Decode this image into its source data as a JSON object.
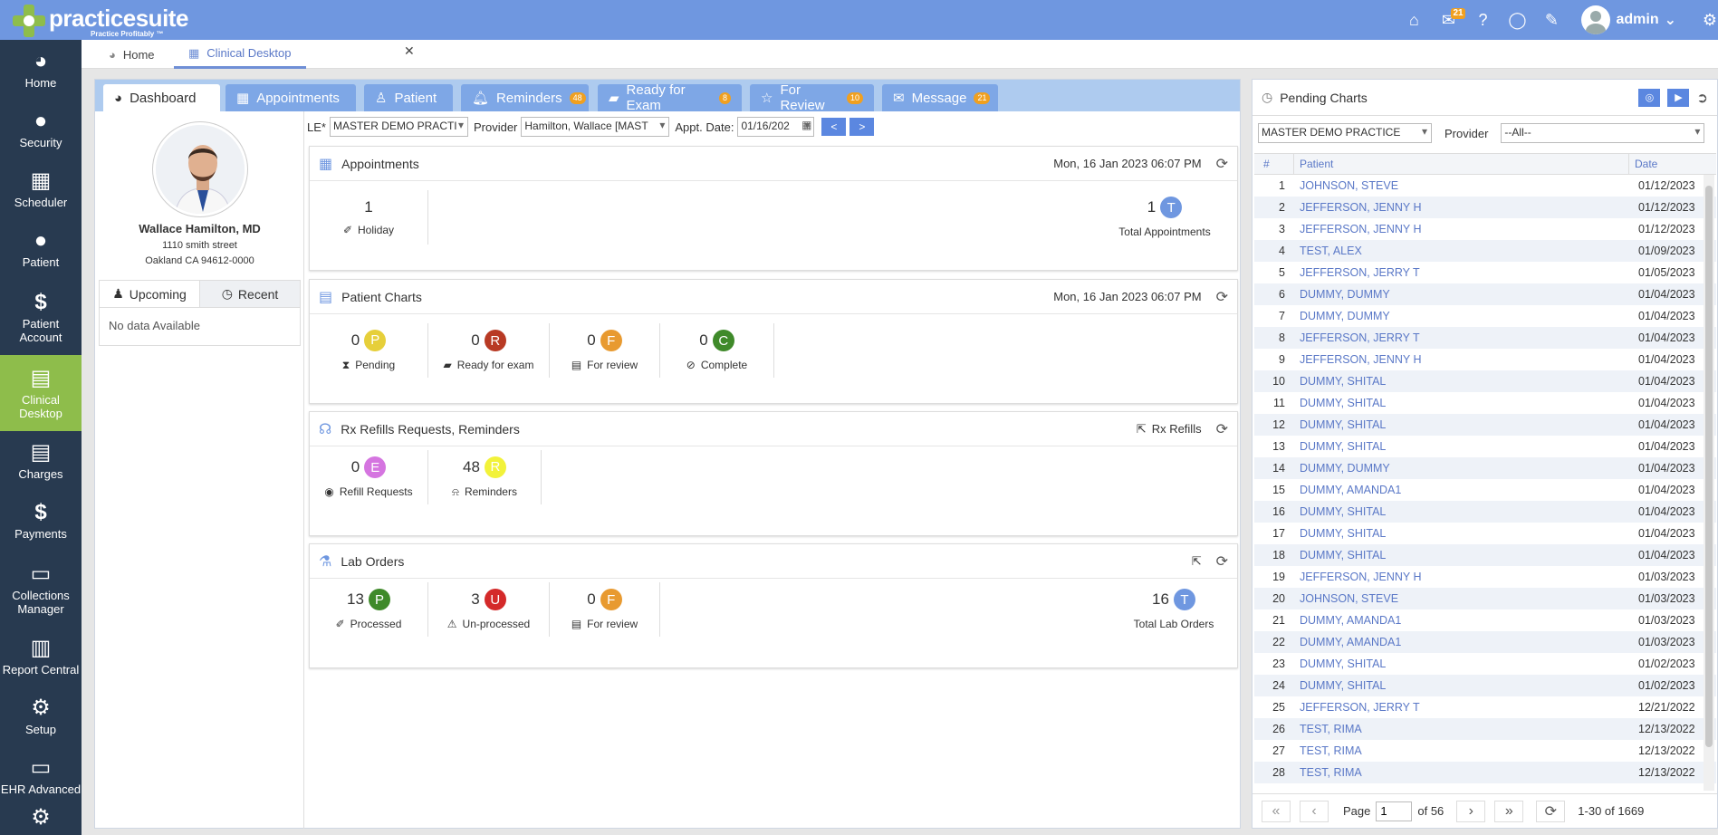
{
  "app": {
    "brand": "practicesuite",
    "tagline": "Practice Profitably ™",
    "user": "admin",
    "mail_badge": "21"
  },
  "sidebar": {
    "items": [
      {
        "label": "Home"
      },
      {
        "label": "Security"
      },
      {
        "label": "Scheduler"
      },
      {
        "label": "Patient"
      },
      {
        "label": "Patient Account"
      },
      {
        "label": "Clinical Desktop"
      },
      {
        "label": "Charges"
      },
      {
        "label": "Payments"
      },
      {
        "label": "Collections Manager"
      },
      {
        "label": "Report Central"
      },
      {
        "label": "Setup"
      },
      {
        "label": "EHR Advanced"
      }
    ]
  },
  "top_tabs": [
    {
      "label": "Home"
    },
    {
      "label": "Clinical Desktop"
    }
  ],
  "dash_tabs": [
    {
      "label": "Dashboard"
    },
    {
      "label": "Appointments"
    },
    {
      "label": "Patient"
    },
    {
      "label": "Reminders",
      "badge": "48"
    },
    {
      "label": "Ready for Exam",
      "badge": "8"
    },
    {
      "label": "For Review",
      "badge": "10"
    },
    {
      "label": "Message",
      "badge": "21"
    }
  ],
  "doctor": {
    "name": "Wallace Hamilton, MD",
    "address1": "1110 smith street",
    "address2": "Oakland CA 94612-0000",
    "tab_upcoming": "Upcoming",
    "tab_recent": "Recent",
    "no_data": "No data Available"
  },
  "filters": {
    "le_label": "LE*",
    "le_value": "MASTER DEMO PRACTI",
    "provider_label": "Provider",
    "provider_value": "Hamilton, Wallace [MAST",
    "date_label": "Appt. Date:",
    "date_value": "01/16/202",
    "prev": "<",
    "next": ">"
  },
  "cards": {
    "appointments": {
      "title": "Appointments",
      "timestamp": "Mon, 16 Jan 2023 06:07 PM",
      "holiday_count": "1",
      "holiday_label": "Holiday",
      "total_count": "1",
      "total_letter": "T",
      "total_label": "Total Appointments"
    },
    "charts": {
      "title": "Patient Charts",
      "timestamp": "Mon, 16 Jan 2023 06:07 PM",
      "items": [
        {
          "count": "0",
          "letter": "P",
          "label": "Pending",
          "color": "#e6cf3a"
        },
        {
          "count": "0",
          "letter": "R",
          "label": "Ready for exam",
          "color": "#b83a24"
        },
        {
          "count": "0",
          "letter": "F",
          "label": "For review",
          "color": "#e89a30"
        },
        {
          "count": "0",
          "letter": "C",
          "label": "Complete",
          "color": "#3f8a2a"
        }
      ]
    },
    "rx": {
      "title": "Rx Refills Requests, Reminders",
      "link": "Rx Refills",
      "items": [
        {
          "count": "0",
          "letter": "E",
          "label": "Refill Requests",
          "color": "#d575e0"
        },
        {
          "count": "48",
          "letter": "R",
          "label": "Reminders",
          "color": "#f2f23a"
        }
      ]
    },
    "lab": {
      "title": "Lab Orders",
      "items": [
        {
          "count": "13",
          "letter": "P",
          "label": "Processed",
          "color": "#3f8a2a"
        },
        {
          "count": "3",
          "letter": "U",
          "label": "Un-processed",
          "color": "#d42a2a"
        },
        {
          "count": "0",
          "letter": "F",
          "label": "For review",
          "color": "#e89a30"
        }
      ],
      "total_count": "16",
      "total_letter": "T",
      "total_label": "Total Lab Orders"
    }
  },
  "pending": {
    "title": "Pending Charts",
    "practice": "MASTER DEMO PRACTICE",
    "provider_label": "Provider",
    "provider_value": "--All--",
    "col_num": "#",
    "col_patient": "Patient",
    "col_date": "Date",
    "rows": [
      [
        "1",
        "JOHNSON, STEVE",
        "01/12/2023"
      ],
      [
        "2",
        "JEFFERSON, JENNY H",
        "01/12/2023"
      ],
      [
        "3",
        "JEFFERSON, JENNY H",
        "01/12/2023"
      ],
      [
        "4",
        "TEST, ALEX",
        "01/09/2023"
      ],
      [
        "5",
        "JEFFERSON, JERRY T",
        "01/05/2023"
      ],
      [
        "6",
        "DUMMY, DUMMY",
        "01/04/2023"
      ],
      [
        "7",
        "DUMMY, DUMMY",
        "01/04/2023"
      ],
      [
        "8",
        "JEFFERSON, JERRY T",
        "01/04/2023"
      ],
      [
        "9",
        "JEFFERSON, JENNY H",
        "01/04/2023"
      ],
      [
        "10",
        "DUMMY, SHITAL",
        "01/04/2023"
      ],
      [
        "11",
        "DUMMY, SHITAL",
        "01/04/2023"
      ],
      [
        "12",
        "DUMMY, SHITAL",
        "01/04/2023"
      ],
      [
        "13",
        "DUMMY, SHITAL",
        "01/04/2023"
      ],
      [
        "14",
        "DUMMY, DUMMY",
        "01/04/2023"
      ],
      [
        "15",
        "DUMMY, AMANDA1",
        "01/04/2023"
      ],
      [
        "16",
        "DUMMY, SHITAL",
        "01/04/2023"
      ],
      [
        "17",
        "DUMMY, SHITAL",
        "01/04/2023"
      ],
      [
        "18",
        "DUMMY, SHITAL",
        "01/04/2023"
      ],
      [
        "19",
        "JEFFERSON, JENNY H",
        "01/03/2023"
      ],
      [
        "20",
        "JOHNSON, STEVE",
        "01/03/2023"
      ],
      [
        "21",
        "DUMMY, AMANDA1",
        "01/03/2023"
      ],
      [
        "22",
        "DUMMY, AMANDA1",
        "01/03/2023"
      ],
      [
        "23",
        "DUMMY, SHITAL",
        "01/02/2023"
      ],
      [
        "24",
        "DUMMY, SHITAL",
        "01/02/2023"
      ],
      [
        "25",
        "JEFFERSON, JERRY T",
        "12/21/2022"
      ],
      [
        "26",
        "TEST, RIMA",
        "12/13/2022"
      ],
      [
        "27",
        "TEST, RIMA",
        "12/13/2022"
      ],
      [
        "28",
        "TEST, RIMA",
        "12/13/2022"
      ]
    ],
    "page_label": "Page",
    "page_value": "1",
    "page_of": "of 56",
    "range": "1-30 of 1669"
  }
}
